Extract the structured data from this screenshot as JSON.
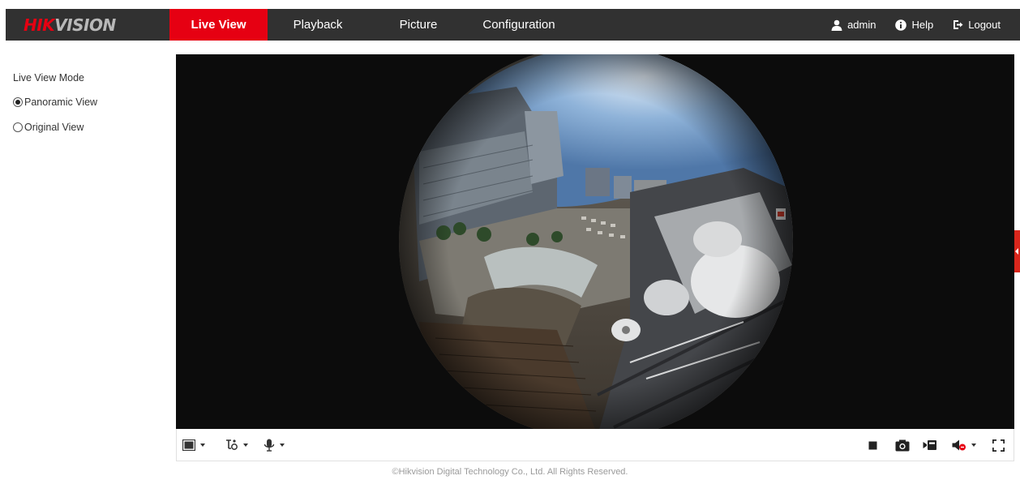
{
  "header": {
    "logo_red": "HIK",
    "logo_grey": "VISION",
    "tabs": [
      {
        "label": "Live View",
        "active": true
      },
      {
        "label": "Playback",
        "active": false
      },
      {
        "label": "Picture",
        "active": false
      },
      {
        "label": "Configuration",
        "active": false
      }
    ],
    "user": {
      "label": "admin",
      "icon": "user-icon"
    },
    "help": {
      "label": "Help",
      "icon": "info-icon"
    },
    "logout": {
      "label": "Logout",
      "icon": "logout-icon"
    }
  },
  "left_panel": {
    "title": "Live View Mode",
    "options": [
      {
        "label": "Panoramic View",
        "checked": true
      },
      {
        "label": "Original View",
        "checked": false
      }
    ]
  },
  "toolbar": {
    "left_icons": [
      "window-layout-icon",
      "stream-type-icon",
      "microphone-icon"
    ],
    "right_icons": [
      "stop-icon",
      "capture-camera-icon",
      "record-icon",
      "audio-muted-icon",
      "fullscreen-icon"
    ]
  },
  "footer": {
    "copyright": "©Hikvision Digital Technology Co., Ltd. All Rights Reserved."
  },
  "colors": {
    "brand_red": "#e60012",
    "nav_bg": "#313131",
    "video_bg": "#0c0c0c"
  }
}
